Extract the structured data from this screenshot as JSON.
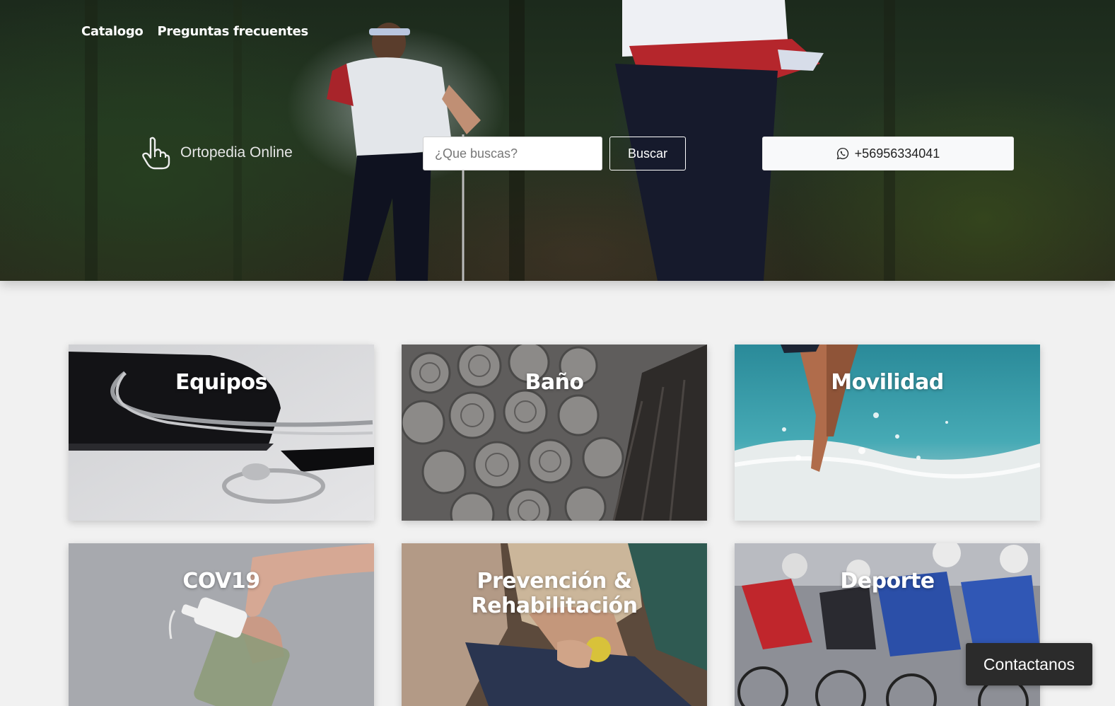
{
  "nav": {
    "items": [
      {
        "label": "Catalogo"
      },
      {
        "label": "Preguntas frecuentes"
      }
    ]
  },
  "brand": {
    "name": "Ortopedia Online",
    "icon": "pointing-hand-icon"
  },
  "search": {
    "placeholder": "¿Que buscas?",
    "button_label": "Buscar"
  },
  "whatsapp": {
    "phone": "+56956334041",
    "icon": "whatsapp-icon"
  },
  "categories": [
    {
      "title": "Equipos"
    },
    {
      "title": "Baño"
    },
    {
      "title": "Movilidad"
    },
    {
      "title": "COV19"
    },
    {
      "title": "Prevención & Rehabilitación"
    },
    {
      "title": "Deporte"
    }
  ],
  "contact": {
    "label": "Contactanos"
  }
}
